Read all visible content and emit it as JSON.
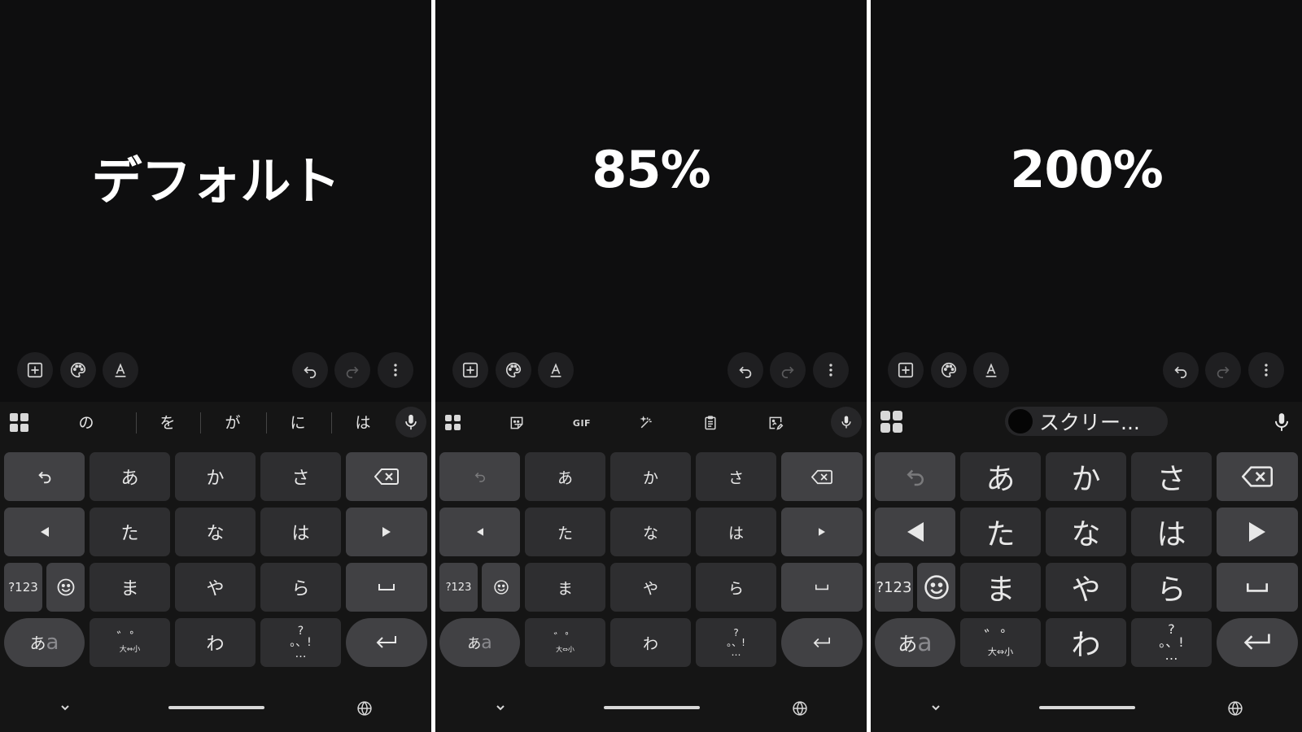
{
  "panels": [
    {
      "title": "デフォルト",
      "suggestions": [
        "の",
        "を",
        "が",
        "に",
        "は"
      ],
      "size": "default"
    },
    {
      "title": "85%",
      "suggestion_icons": [
        "sticker-icon",
        "gif-icon",
        "magic-icon",
        "clipboard-icon",
        "edit-image-icon"
      ],
      "gif_label": "GIF",
      "size": "small"
    },
    {
      "title": "200%",
      "chip_label": "スクリー...",
      "size": "large"
    }
  ],
  "keys": {
    "row1": [
      "あ",
      "か",
      "さ"
    ],
    "row2": [
      "た",
      "な",
      "は"
    ],
    "row3": [
      "ま",
      "や",
      "ら"
    ],
    "row4_mid": "わ",
    "num": "?123",
    "kana": "あ",
    "kana_latin": "a",
    "dakuten_top": "゛゜",
    "dakuten_bottom": "大⇔小",
    "punct_top": "?",
    "punct_mid": "。、!",
    "punct_bot": "…"
  },
  "colors": {
    "panel_bg": "#0e0e0f",
    "key_bg": "#2e2e30",
    "fn_key_bg": "#414144",
    "text": "#e8e8e8"
  }
}
